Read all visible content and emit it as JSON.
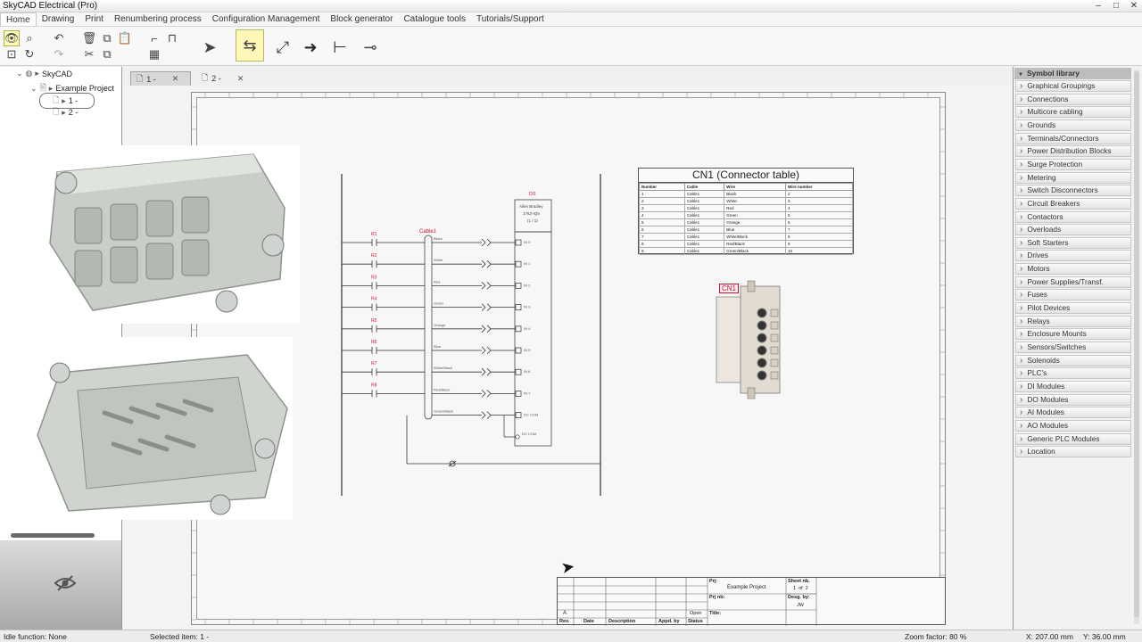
{
  "window": {
    "title": "SkyCAD Electrical (Pro)",
    "controls": [
      "–",
      "□",
      "✕"
    ]
  },
  "menu": [
    "Home",
    "Drawing",
    "Print",
    "Renumbering process",
    "Configuration Management",
    "Block generator",
    "Catalogue tools",
    "Tutorials/Support"
  ],
  "tree": {
    "root": "SkyCAD",
    "project": "Example Project",
    "pages": [
      "1 -",
      "2 -"
    ]
  },
  "tabs": [
    {
      "label": "1 -",
      "close": "✕"
    },
    {
      "label": "2 -",
      "close": "✕"
    }
  ],
  "library": {
    "header": "Symbol library",
    "items": [
      "Graphical Groupings",
      "Connections",
      "Multicore cabling",
      "Grounds",
      "Terminals/Connectors",
      "Power Distribution Blocks",
      "Surge Protection",
      "Metering",
      "Switch Disconnectors",
      "Circuit Breakers",
      "Contactors",
      "Overloads",
      "Soft Starters",
      "Drives",
      "Motors",
      "Power Supplies/Transf.",
      "Fuses",
      "Pilot Devices",
      "Relays",
      "Enclosure Mounts",
      "Sensors/Switches",
      "Solenoids",
      "PLC's",
      "DI Modules",
      "DO Modules",
      "AI Modules",
      "AO Modules",
      "Generic PLC Modules",
      "Location"
    ]
  },
  "schematic": {
    "cable_label": "Cable1",
    "module": {
      "tag": "DI1",
      "maker": "Allen Bradley",
      "part": "1762-IQ8",
      "ratio": "(1 / 1)"
    },
    "resistors": [
      "R1",
      "R2",
      "R3",
      "R4",
      "R5",
      "R6",
      "R7",
      "R8"
    ],
    "wires": [
      "Black",
      "White",
      "Red",
      "Green",
      "Orange",
      "Blue",
      "White/Black",
      "Red/Black",
      "Green/Black"
    ],
    "inputs": [
      "IN 0",
      "IN 1",
      "IN 2",
      "IN 3",
      "IN 4",
      "IN 5",
      "IN 6",
      "IN 7",
      "DC COM",
      "DC COM"
    ],
    "connector_tag": "CN1"
  },
  "connector_table": {
    "title": "CN1 (Connector table)",
    "columns": [
      "Number",
      "Cable",
      "Wire",
      "Wire number"
    ],
    "rows": [
      [
        "1",
        "Cable1",
        "Black",
        "2"
      ],
      [
        "2",
        "Cable1",
        "White",
        "3"
      ],
      [
        "3",
        "Cable1",
        "Red",
        "4"
      ],
      [
        "4",
        "Cable1",
        "Green",
        "5"
      ],
      [
        "5",
        "Cable1",
        "Orange",
        "6"
      ],
      [
        "6",
        "Cable1",
        "Blue",
        "7"
      ],
      [
        "7",
        "Cable1",
        "White/Black",
        "8"
      ],
      [
        "8",
        "Cable1",
        "Red/Black",
        "9"
      ],
      [
        "9",
        "Cable1",
        "Green/Black",
        "10"
      ]
    ]
  },
  "title_block": {
    "rev_row": [
      "A",
      "",
      "",
      "",
      "Open"
    ],
    "rev_headers": [
      "Rev.",
      "Date",
      "Description",
      "Appd. by",
      "Status"
    ],
    "prj_label": "Prj:",
    "prj_value": "Example Project",
    "prj_nb_label": "Prj nb:",
    "title_label": "Title:",
    "sheet_label": "Sheet nb.",
    "sheet_value": "1  of  2",
    "desg_label": "Desg. by:",
    "desg_value": "JW"
  },
  "status": {
    "idle": "Idle function: None",
    "selected": "Selected item: 1 -",
    "zoom": "Zoom factor: 80 %",
    "x": "X: 207.00 mm",
    "y": "Y: 36.00 mm"
  },
  "colors": {
    "accent": "#c8102e",
    "toolbar_select": "#fff7b8"
  }
}
